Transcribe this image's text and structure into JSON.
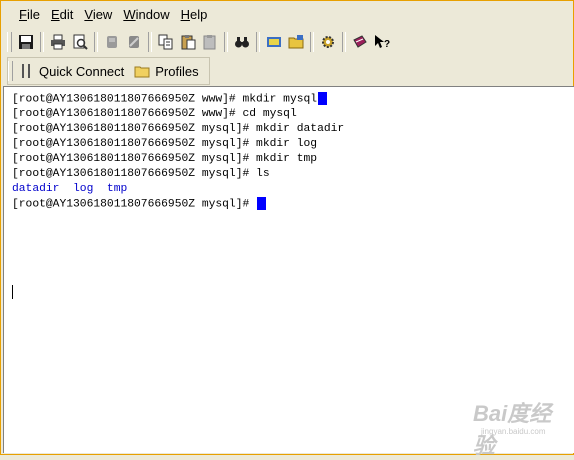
{
  "menu": [
    "File",
    "Edit",
    "View",
    "Window",
    "Help"
  ],
  "toolbar": {
    "icons": [
      "save-icon",
      "print-icon",
      "print-preview-icon",
      "disconnect-icon",
      "reconnect-icon",
      "copy-icon",
      "paste-icon",
      "paste-special-icon",
      "find-icon",
      "new-file-transfer-icon",
      "open-folder-icon",
      "settings-icon",
      "keys-book-icon",
      "help-whats-this-icon"
    ]
  },
  "quick_connect": {
    "label": "Quick Connect",
    "profiles_label": "Profiles"
  },
  "terminal": {
    "lines": [
      "[root@AY130618011807666950Z www]# mkdir mysql",
      "[root@AY130618011807666950Z www]# cd mysql",
      "[root@AY130618011807666950Z mysql]# mkdir datadir",
      "[root@AY130618011807666950Z mysql]# mkdir log",
      "[root@AY130618011807666950Z mysql]# mkdir tmp",
      "[root@AY130618011807666950Z mysql]# ls",
      "datadir  log  tmp",
      "[root@AY130618011807666950Z mysql]# "
    ],
    "cursor_color": "#0000ff",
    "listing_color": "#0000cc"
  },
  "watermark": {
    "logo": "Bai度经验",
    "url": "jingyan.baidu.com"
  }
}
